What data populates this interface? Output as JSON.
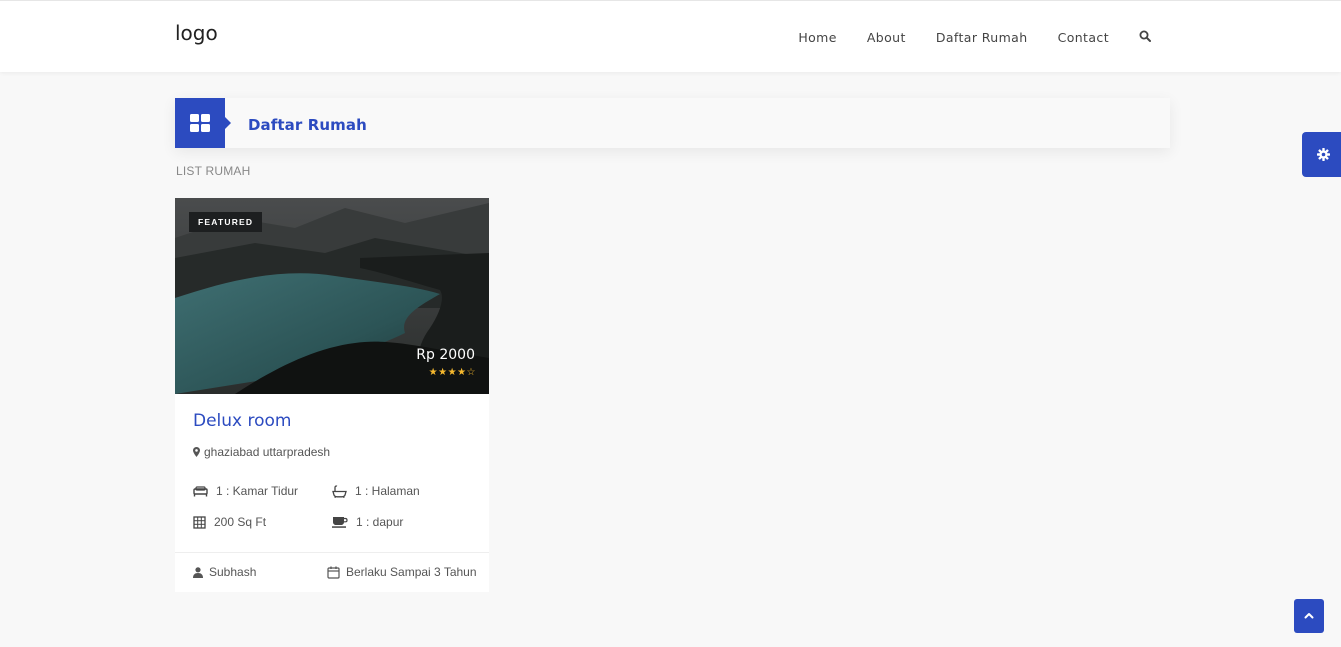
{
  "header": {
    "logo": "logo",
    "nav": [
      "Home",
      "About",
      "Daftar Rumah",
      "Contact"
    ]
  },
  "section": {
    "title": "Daftar Rumah",
    "list_label": "LIST RUMAH"
  },
  "listing": {
    "badge": "FEATURED",
    "price": "Rp 2000",
    "rating": 4,
    "rating_max": 5,
    "stars": "★★★★☆",
    "title": "Delux room",
    "location": "ghaziabad uttarpradesh",
    "features": {
      "bedroom": "1 : Kamar Tidur",
      "yard": "1 : Halaman",
      "area": "200 Sq Ft",
      "kitchen": "1 : dapur"
    },
    "owner": "Subhash",
    "validity": "Berlaku Sampai 3 Tahun"
  },
  "colors": {
    "accent": "#2c4bc0",
    "star": "#f5b82e",
    "background": "#f8f8f8"
  },
  "icons": {
    "search": "search-icon",
    "grid": "grid-icon",
    "settings": "gear-icon",
    "back_to_top": "chevron-up-icon"
  }
}
